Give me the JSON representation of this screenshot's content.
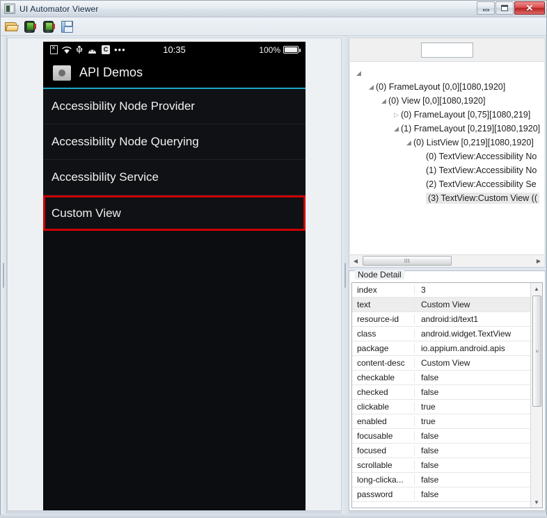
{
  "window": {
    "title": "UI Automator Viewer",
    "app_icon": "app-window-icon",
    "buttons": {
      "minimize": "—",
      "maximize": "□",
      "close": "✕"
    }
  },
  "toolbar": {
    "items": [
      {
        "name": "open-file-icon",
        "glyph": "folder-open"
      },
      {
        "name": "device-screenshot-icon",
        "glyph": "device-green"
      },
      {
        "name": "device-screenshot-compressed-icon",
        "glyph": "device-green2"
      },
      {
        "name": "save-icon",
        "glyph": "floppy-disk"
      }
    ]
  },
  "screenshot_panel": {
    "statusbar": {
      "icons": [
        "sim-x-icon",
        "wifi-icon",
        "usb-icon",
        "android-robot-icon",
        "calendar-icon",
        "more-dots-icon"
      ],
      "calendar_glyph": "C",
      "more_glyph": "•••",
      "time": "10:35",
      "battery_percent": "100%"
    },
    "app_header": {
      "icon": "folder-bug-icon",
      "title": "API Demos",
      "accent_color": "#19a9c4"
    },
    "list_items": [
      {
        "label": "Accessibility Node Provider",
        "selected": false
      },
      {
        "label": "Accessibility Node Querying",
        "selected": false
      },
      {
        "label": "Accessibility Service",
        "selected": false
      },
      {
        "label": "Custom View",
        "selected": true
      }
    ],
    "selection_color": "#cc0000"
  },
  "tree_panel": {
    "search_value": "",
    "search_placeholder": "",
    "nodes": [
      {
        "indent": 0,
        "arrow": "open",
        "label": "",
        "selected": false
      },
      {
        "indent": 1,
        "arrow": "open",
        "label": "(0) FrameLayout [0,0][1080,1920]",
        "selected": false
      },
      {
        "indent": 2,
        "arrow": "open",
        "label": "(0) View [0,0][1080,1920]",
        "selected": false
      },
      {
        "indent": 3,
        "arrow": "closed",
        "label": "(0) FrameLayout [0,75][1080,219]",
        "selected": false
      },
      {
        "indent": 3,
        "arrow": "open",
        "label": "(1) FrameLayout [0,219][1080,1920]",
        "selected": false
      },
      {
        "indent": 4,
        "arrow": "open",
        "label": "(0) ListView [0,219][1080,1920]",
        "selected": false
      },
      {
        "indent": 5,
        "arrow": "none",
        "label": "(0) TextView:Accessibility No",
        "selected": false
      },
      {
        "indent": 5,
        "arrow": "none",
        "label": "(1) TextView:Accessibility No",
        "selected": false
      },
      {
        "indent": 5,
        "arrow": "none",
        "label": "(2) TextView:Accessibility Se",
        "selected": false
      },
      {
        "indent": 5,
        "arrow": "none",
        "label": "(3) TextView:Custom View ((",
        "selected": true
      }
    ],
    "hscroll": {
      "left_arrow": "◀",
      "right_arrow": "▶",
      "thumb_grip": "III"
    }
  },
  "detail_panel": {
    "legend": "Node Detail",
    "rows": [
      {
        "key": "index",
        "value": "3",
        "selected": false
      },
      {
        "key": "text",
        "value": "Custom View",
        "selected": true
      },
      {
        "key": "resource-id",
        "value": "android:id/text1",
        "selected": false
      },
      {
        "key": "class",
        "value": "android.widget.TextView",
        "selected": false
      },
      {
        "key": "package",
        "value": "io.appium.android.apis",
        "selected": false
      },
      {
        "key": "content-desc",
        "value": "Custom View",
        "selected": false
      },
      {
        "key": "checkable",
        "value": "false",
        "selected": false
      },
      {
        "key": "checked",
        "value": "false",
        "selected": false
      },
      {
        "key": "clickable",
        "value": "true",
        "selected": false
      },
      {
        "key": "enabled",
        "value": "true",
        "selected": false
      },
      {
        "key": "focusable",
        "value": "false",
        "selected": false
      },
      {
        "key": "focused",
        "value": "false",
        "selected": false
      },
      {
        "key": "scrollable",
        "value": "false",
        "selected": false
      },
      {
        "key": "long-clicka...",
        "value": "false",
        "selected": false
      },
      {
        "key": "password",
        "value": "false",
        "selected": false
      }
    ],
    "vscroll": {
      "up_arrow": "▲",
      "down_arrow": "▼",
      "thumb_grip": "≡"
    }
  }
}
